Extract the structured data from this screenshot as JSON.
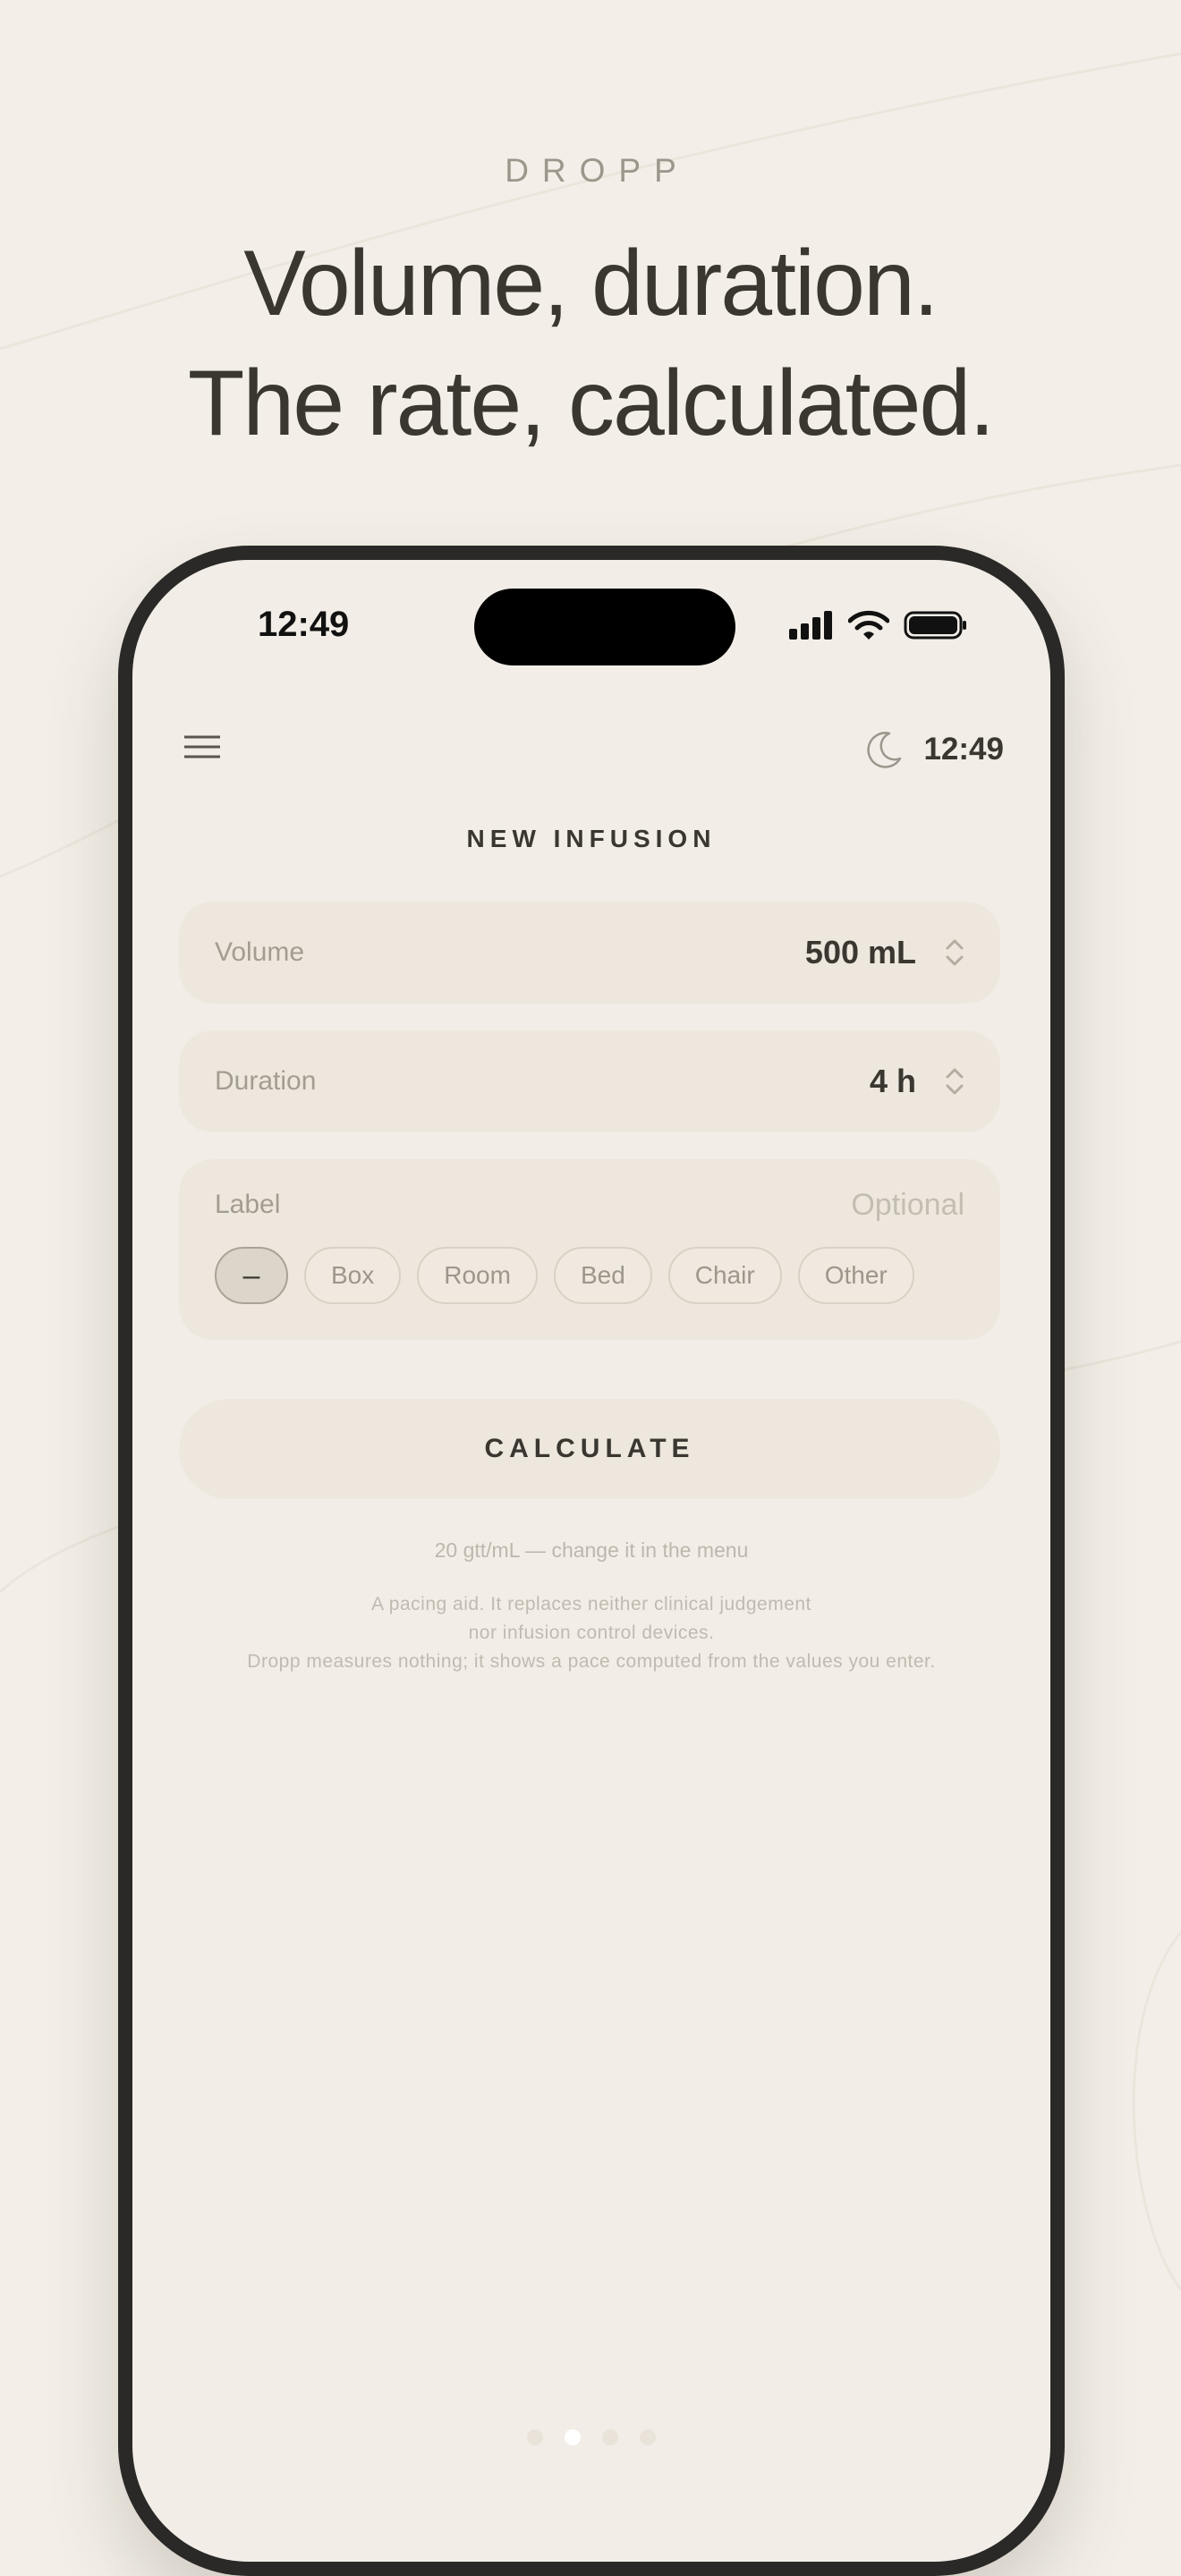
{
  "header": {
    "brand": "DROPP",
    "headline_line1": "Volume, duration.",
    "headline_line2": "The rate, calculated."
  },
  "status_bar": {
    "time": "12:49",
    "icons": [
      "cellular-signal-icon",
      "wifi-icon",
      "battery-icon"
    ]
  },
  "app_bar": {
    "menu_icon": "hamburger-menu-icon",
    "theme_icon": "moon-icon",
    "time": "12:49"
  },
  "screen": {
    "title": "NEW INFUSION",
    "volume": {
      "label": "Volume",
      "value": "500 mL"
    },
    "duration": {
      "label": "Duration",
      "value": "4 h"
    },
    "label_field": {
      "label": "Label",
      "placeholder": "Optional",
      "chips": [
        "–",
        "Box",
        "Room",
        "Bed",
        "Chair",
        "Other"
      ],
      "selected_chip": "–"
    },
    "calculate_button": "CALCULATE",
    "hint": "20 gtt/mL — change it in the menu",
    "disclaimer_line1": "A pacing aid. It replaces neither clinical judgement",
    "disclaimer_line2": "nor infusion control devices.",
    "disclaimer_line3": "Dropp measures nothing; it shows a pace computed from the values you enter."
  },
  "pagination": {
    "total": 4,
    "active_index": 1
  },
  "colors": {
    "background": "#f3efe8",
    "screen": "#f2eee7",
    "card": "#ede7dd",
    "text_primary": "#3a3731",
    "text_muted": "#a29c91"
  }
}
